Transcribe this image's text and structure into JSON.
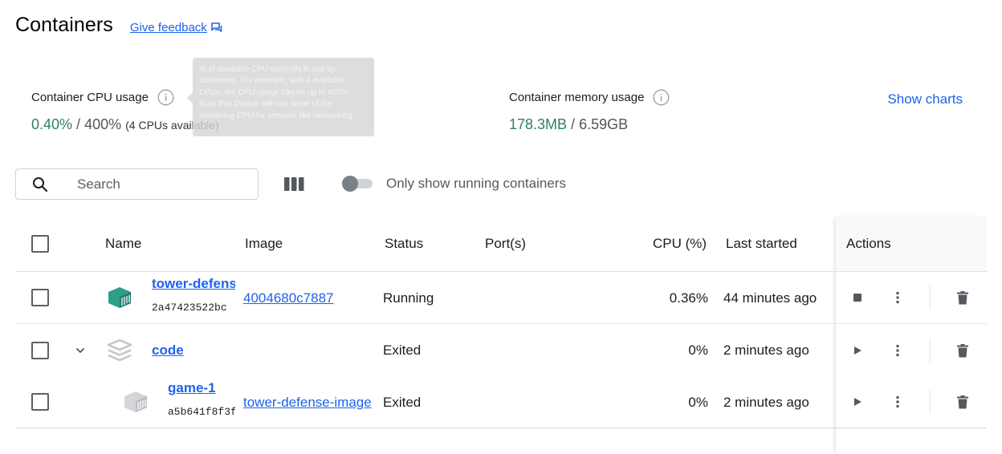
{
  "header": {
    "title": "Containers",
    "feedback_label": "Give feedback",
    "feedback_icon": "feedback-icon"
  },
  "stats": {
    "cpu": {
      "label": "Container CPU usage",
      "used": "0.40%",
      "separator": " / ",
      "total": "400%",
      "note": "(4 CPUs available)"
    },
    "memory": {
      "label": "Container memory usage",
      "used": "178.3MB",
      "separator": " / ",
      "total": "6.59GB"
    },
    "show_charts_label": "Show charts"
  },
  "tooltip": {
    "text": "% of available CPU currently in use by containers. For example, with 4 available CPUs, the CPU usage can be up to 400%. Note that Docker will use some of the remaining CPU for services like networking."
  },
  "toolbar": {
    "search_placeholder": "Search",
    "toggle_label": "Only show running containers",
    "toggle_on": false
  },
  "table": {
    "columns": {
      "name": "Name",
      "image": "Image",
      "status": "Status",
      "ports": "Port(s)",
      "cpu": "CPU (%)",
      "last_started": "Last started",
      "actions": "Actions"
    },
    "rows": [
      {
        "name": "tower-defense",
        "id": "2a47423522bc",
        "image": "4004680c7887",
        "status": "Running",
        "ports": "",
        "cpu": "0.36%",
        "last_started": "44 minutes ago",
        "primary_action_icon": "stop-icon"
      },
      {
        "name": "code",
        "id": "",
        "image": "",
        "status": "Exited",
        "ports": "",
        "cpu": "0%",
        "last_started": "2 minutes ago",
        "primary_action_icon": "play-icon"
      },
      {
        "name": "game-1",
        "id": "a5b641f8f3f",
        "image": "tower-defense-image",
        "status": "Exited",
        "ports": "",
        "cpu": "0%",
        "last_started": "2 minutes ago",
        "primary_action_icon": "play-icon"
      }
    ]
  },
  "colors": {
    "accent": "#1d63ed",
    "usage_green": "#2e7d6b",
    "container_running": "#2d9e88",
    "container_stopped": "#c5c8cc"
  }
}
